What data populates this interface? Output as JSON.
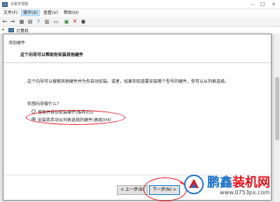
{
  "window": {
    "title": "设备管理器"
  },
  "menu": [
    {
      "label": "文件(F)",
      "active": false
    },
    {
      "label": "操作(A)",
      "active": true
    },
    {
      "label": "查看(V)",
      "active": false
    },
    {
      "label": "帮助(H)",
      "active": false
    }
  ],
  "toolbar": {
    "icons": [
      "back-arrow-icon",
      "forward-arrow-icon",
      "properties-icon",
      "update-driver-icon",
      "help-icon",
      "scan-hardware-icon",
      "monitor-icon",
      "add-device-icon",
      "uninstall-icon",
      "enable-device-icon"
    ]
  },
  "tree": {
    "root_label": "计算机"
  },
  "dialog": {
    "caption": "添加硬件",
    "header_title": "这个向导可以帮助你安装其他硬件",
    "description": "这个向导可以搜索其他硬件并为你自动安装。或者，如果你知道要安装哪个型号的硬件，你可以从列表选择。",
    "question": "你想向导做什么？",
    "options": [
      {
        "label": "搜索并自动安装硬件(推荐)(S)",
        "checked": false
      },
      {
        "label": "安装我手动从列表选择的硬件(高级)(M)",
        "checked": true
      }
    ],
    "buttons": {
      "back": "< 上一步(B)",
      "next": "下一步(N) >"
    }
  },
  "annotations": {
    "color": "#e8101a"
  },
  "watermark": {
    "brand_main": "鹏鑫",
    "brand_accent": "装机网",
    "domain": "www.0753px.com"
  }
}
